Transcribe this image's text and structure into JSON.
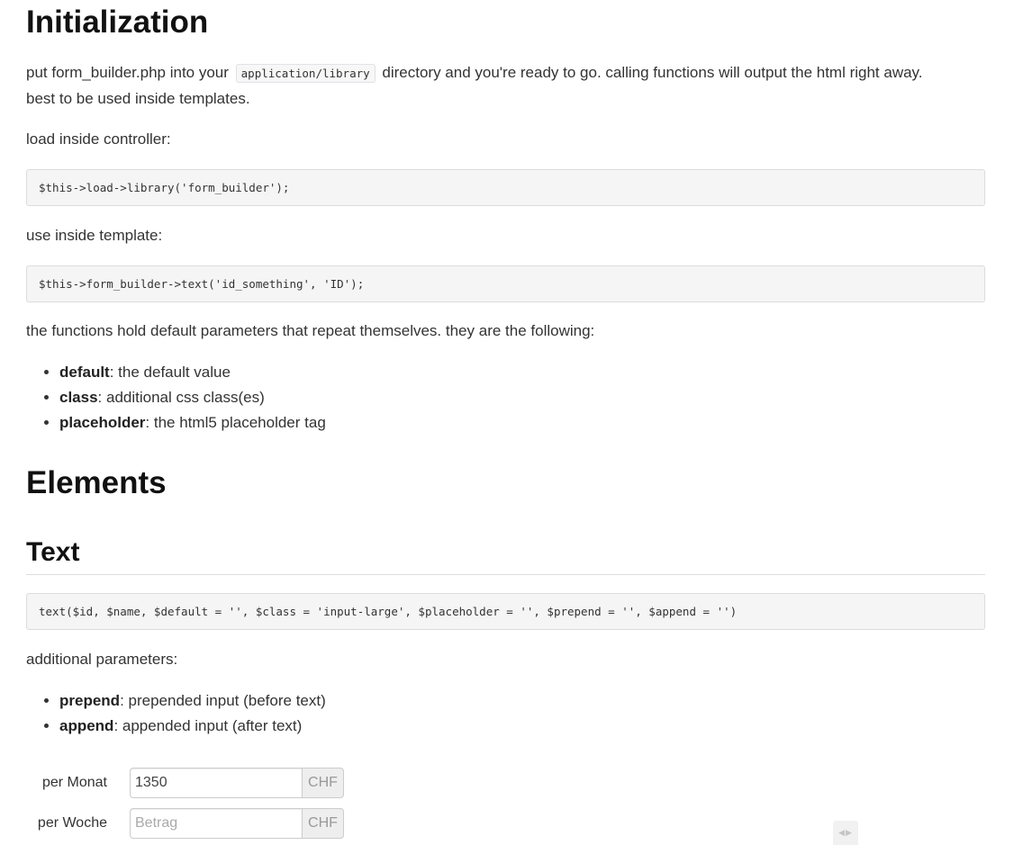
{
  "initialization": {
    "heading": "Initialization",
    "intro_pre": "put form_builder.php into your",
    "intro_code": "application/library",
    "intro_post": "directory and you're ready to go. calling functions will output the html right away.",
    "intro_line2": "best to be used inside templates.",
    "load_label": "load inside controller:",
    "load_code": "$this->load->library('form_builder');",
    "use_label": "use inside template:",
    "use_code": "$this->form_builder->text('id_something', 'ID');",
    "params_intro": "the functions hold default parameters that repeat themselves. they are the following:",
    "params": [
      {
        "name": "default",
        "desc": ": the default value"
      },
      {
        "name": "class",
        "desc": ": additional css class(es)"
      },
      {
        "name": "placeholder",
        "desc": ": the html5 placeholder tag"
      }
    ]
  },
  "elements": {
    "heading": "Elements"
  },
  "text_section": {
    "heading": "Text",
    "signature": "text($id, $name, $default = '', $class = 'input-large', $placeholder = '', $prepend = '', $append = '')",
    "additional_label": "additional parameters:",
    "params": [
      {
        "name": "prepend",
        "desc": ": prepended input (before text)"
      },
      {
        "name": "append",
        "desc": ": appended input (after text)"
      }
    ]
  },
  "demo_form": {
    "rows": [
      {
        "label": "per Monat",
        "value": "1350",
        "placeholder": "",
        "addon": "CHF"
      },
      {
        "label": "per Woche",
        "value": "",
        "placeholder": "Betrag",
        "addon": "CHF"
      }
    ]
  },
  "scroll_widget": {
    "glyph": "◀▶",
    "icon": "horizontal-scroll-icon"
  }
}
